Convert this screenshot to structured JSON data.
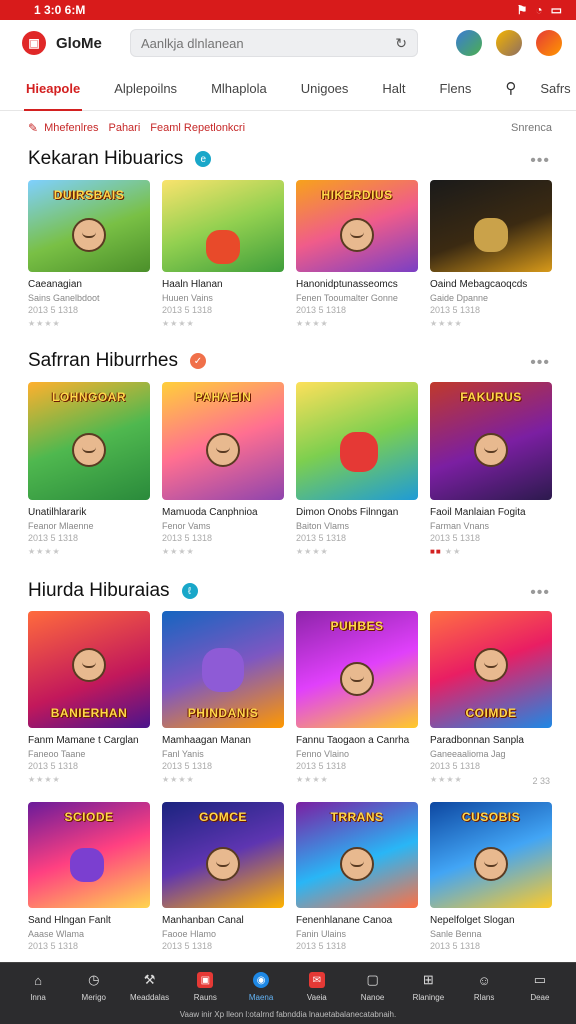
{
  "status": {
    "time": "1 3:0 6:M"
  },
  "app": {
    "name": "GloMe",
    "search_placeholder": "Aanlkja dlnlanean"
  },
  "tabs": [
    "Hieapole",
    "Alplepoilns",
    "Mlhaplola",
    "Unigoes",
    "Halt",
    "Flens"
  ],
  "tab_last": "Safrs",
  "filters": {
    "items": [
      "Mhefenlres",
      "Pahari",
      "Feaml Repetlonkcri"
    ],
    "right": "Snrenca"
  },
  "sections": [
    {
      "title": "Kekaran Hibuarics",
      "badge_color": "#19a7c9",
      "cards": [
        {
          "art": "DUIRSBAIS",
          "title": "Caeanagian",
          "sub": "Sains Ganelbdoot",
          "meta": "2013  5  1318"
        },
        {
          "art": "",
          "title": "Haaln Hlanan",
          "sub": "Huuen Vains",
          "meta": "2013  5  1318"
        },
        {
          "art": "HIKBRDIUS",
          "title": "Hanonidptunasseomcs",
          "sub": "Fenen Tooumalter Gonne",
          "meta": "2013  5  1318"
        },
        {
          "art": "",
          "title": "Oaind Mebagcaoqcds",
          "sub": "Gaide Dpanne",
          "meta": "2013  5  1318"
        }
      ]
    },
    {
      "title": "Safrran Hiburrhes",
      "badge_color": "#f0704a",
      "cards": [
        {
          "art": "LOHNGOAR",
          "title": "Unatilhlararik",
          "sub": "Feanor Mlaenne",
          "meta": "2013  5  1318"
        },
        {
          "art": "PAHAEIN",
          "title": "Mamuoda Canphnioa",
          "sub": "Fenor Vams",
          "meta": "2013  5  1318"
        },
        {
          "art": "",
          "title": "Dimon Onobs Filnngan",
          "sub": "Baiton Vlams",
          "meta": "2013  5  1318"
        },
        {
          "art": "FAKURUS",
          "title": "Faoil Manlaian Fogita",
          "sub": "Farman Vnans",
          "meta": "2013  5  1318"
        }
      ]
    },
    {
      "title": "Hiurda Hiburaias",
      "badge_color": "#19a7c9",
      "cards": [
        {
          "art": "BANIERHAN",
          "title": "Fanm Mamane t Carglan",
          "sub": "Faneoo Taane",
          "meta": "2013  5  1318"
        },
        {
          "art": "PHINDANIS",
          "title": "Mamhaagan Manan",
          "sub": "Fanl Yanis",
          "meta": "2013  5  1318"
        },
        {
          "art": "PUHBES",
          "title": "Fannu Taogaon a Canrha",
          "sub": "Fenno Vlaino",
          "meta": "2013  5  1318"
        },
        {
          "art": "COIMDE",
          "title": "Paradbonnan Sanpla",
          "sub": "Ganeeaalioma Jag",
          "meta": "2013  5  1318"
        }
      ],
      "count": "2 33"
    },
    {
      "title": "",
      "cards": [
        {
          "art": "SCIODE",
          "title": "Sand Hlngan Fanlt",
          "sub": "Aaase Wlama",
          "meta": "2013  5  1318"
        },
        {
          "art": "GOMCE",
          "title": "Manhanban Canal",
          "sub": "Faooe Hlamo",
          "meta": "2013  5  1318"
        },
        {
          "art": "TRRANS",
          "title": "Fenenhlanane Canoa",
          "sub": "Fanin Ulains",
          "meta": "2013  5  1318"
        },
        {
          "art": "CUSOBIS",
          "title": "Nepelfolget Slogan",
          "sub": "Sanle Benna",
          "meta": "2013  5  1318"
        }
      ]
    }
  ],
  "bottom_nav": [
    "Inna",
    "Merigo",
    "Meaddalas",
    "Rauns",
    "Maena",
    "Vaeia",
    "Nanoe",
    "Rlaninge",
    "Rlans",
    "Deae"
  ],
  "footer": "Vaaw inir Xp lleon l:otalrnd fabnddia lnauetabalanecatabnaih."
}
